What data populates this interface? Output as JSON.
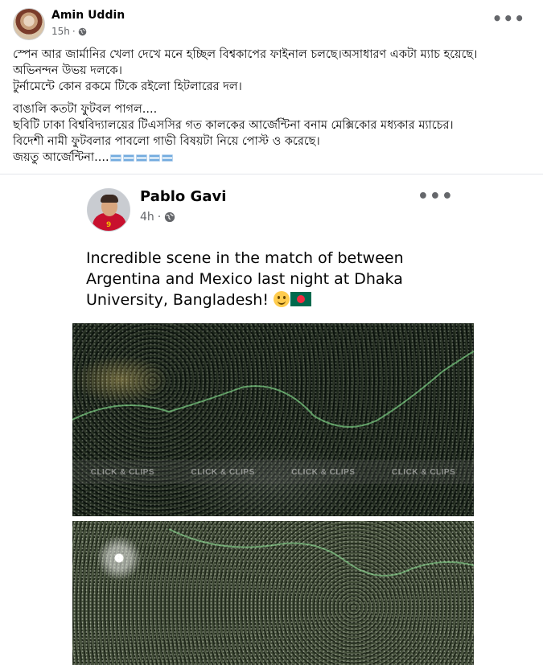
{
  "post": {
    "author": "Amin Uddin",
    "time": "15h",
    "dot": "·",
    "lines": [
      "স্পেন আর জার্মানির খেলা দেখে মনে হচ্ছিল বিশ্বকাপের ফাইনাল চলছে।অসাধারণ একটা ম্যাচ হয়েছে।",
      "অভিনন্দন উভয় দলকে।",
      "টুর্নামেন্টে কোন রকমে টিকে রইলো হিটলারের দল।"
    ],
    "lines2": [
      "বাঙালি কতটা ফুটবল পাগল....",
      "ছবিটি ঢাকা বিশ্ববিদ্যালয়ের টিএসসির গত কালকের আর্জেন্টিনা বনাম মেক্সিকোর মধ্যকার ম্যাচের।",
      "বিদেশী নামী ফুটবলার পাবলো গাভী বিষয়টা নিয়ে পোস্ট ও করেছে।",
      "জয়তু আর্জেন্টিনা...."
    ],
    "more": "•••"
  },
  "shared_post": {
    "author": "Pablo Gavi",
    "time": "4h",
    "dot": "·",
    "text": "Incredible scene in the match of between Argentina and Mexico last night at Dhaka University, Bangladesh!",
    "more": "•••",
    "avatar_number": "9"
  },
  "watermark": {
    "items": [
      "CLICK & CLIPS",
      "CLICK & CLIPS",
      "CLICK & CLIPS",
      "CLICK & CLIPS"
    ]
  },
  "colors": {
    "secondary_text": "#65676b",
    "divider": "#e4e6eb",
    "argentina_blue": "#74acdf",
    "bangladesh_green": "#006a4e",
    "bangladesh_red": "#f42a41"
  },
  "icons": [
    "globe-icon",
    "more-options-icon",
    "argentina-flag-icon",
    "smile-emoji-icon",
    "bangladesh-flag-icon"
  ]
}
